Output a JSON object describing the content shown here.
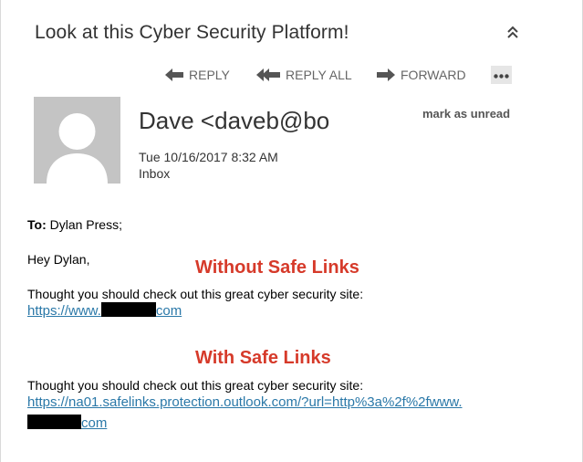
{
  "email": {
    "subject": "Look at this Cyber Security Platform!",
    "toolbar": {
      "reply": "REPLY",
      "reply_all": "REPLY ALL",
      "forward": "FORWARD"
    },
    "sender": "Dave <daveb@bo",
    "mark_unread": "mark as unread",
    "datetime": "Tue 10/16/2017 8:32 AM",
    "folder": "Inbox",
    "to_label": "To:",
    "to_value": "Dylan Press;",
    "greeting": "Hey Dylan,",
    "section1": {
      "caption": "Without Safe Links",
      "text": "Thought you should check out this great cyber security site:",
      "link_prefix": "https://www.",
      "link_suffix": "com"
    },
    "section2": {
      "caption": "With Safe Links",
      "text": "Thought you should check out this great cyber security site:",
      "link_line1": "https://na01.safelinks.protection.outlook.com/?url=http%3a%2f%2fwww.",
      "link_suffix": "com"
    }
  },
  "icons": {
    "collapse": "double-chevron-up-icon",
    "reply": "arrow-left-icon",
    "reply_all": "double-arrow-left-icon",
    "forward": "arrow-right-icon",
    "more": "ellipsis-icon",
    "avatar": "person-silhouette-icon"
  },
  "colors": {
    "caption": "#d63a2a",
    "link": "#2a78a8",
    "avatar_bg": "#c4c4c4",
    "toolbar_text": "#666666"
  }
}
